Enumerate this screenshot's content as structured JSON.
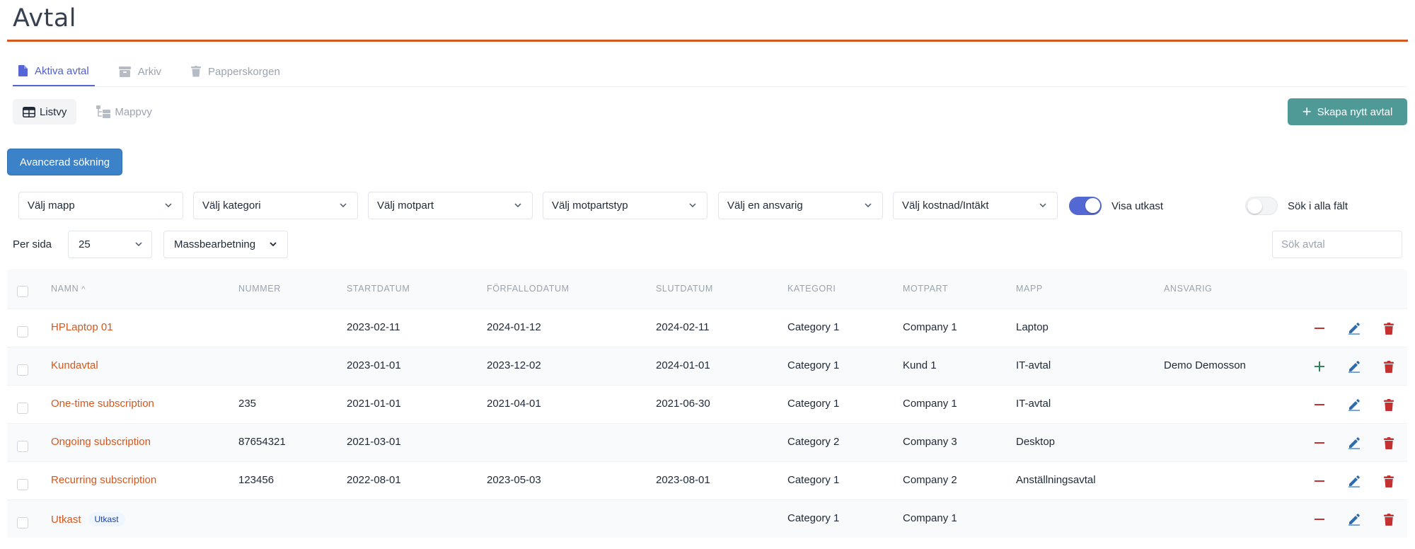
{
  "page": {
    "title": "Avtal"
  },
  "tabs": [
    {
      "label": "Aktiva avtal",
      "icon": "file-icon",
      "active": true
    },
    {
      "label": "Arkiv",
      "icon": "archive-icon",
      "active": false
    },
    {
      "label": "Papperskorgen",
      "icon": "trash-icon",
      "active": false
    }
  ],
  "views": [
    {
      "label": "Listvy",
      "icon": "table-icon",
      "active": true
    },
    {
      "label": "Mappvy",
      "icon": "folder-tree-icon",
      "active": false
    }
  ],
  "actions": {
    "create_label": "Skapa nytt avtal",
    "advanced_search_label": "Avancerad sökning"
  },
  "filters": [
    {
      "placeholder": "Välj mapp"
    },
    {
      "placeholder": "Välj kategori"
    },
    {
      "placeholder": "Välj motpart"
    },
    {
      "placeholder": "Välj motpartstyp"
    },
    {
      "placeholder": "Välj en ansvarig"
    },
    {
      "placeholder": "Välj kostnad/Intäkt"
    }
  ],
  "toggles": {
    "drafts": {
      "label": "Visa utkast",
      "on": true
    },
    "all_fields": {
      "label": "Sök i alla fält",
      "on": false
    }
  },
  "paging": {
    "per_page_label": "Per sida",
    "per_page_value": "25",
    "mass_label": "Massbearbetning"
  },
  "search": {
    "placeholder": "Sök avtal",
    "value": ""
  },
  "table": {
    "columns": [
      "NAMN",
      "NUMMER",
      "STARTDATUM",
      "FÖRFALLODATUM",
      "SLUTDATUM",
      "KATEGORI",
      "MOTPART",
      "MAPP",
      "ANSVARIG"
    ],
    "sort_indicator": "^",
    "rows": [
      {
        "name": "HPLaptop 01",
        "number": "",
        "start": "2023-02-11",
        "due": "2024-01-12",
        "end": "2024-02-11",
        "category": "Category 1",
        "party": "Company 1",
        "folder": "Laptop",
        "owner": "",
        "badge": "",
        "toggle": "minus"
      },
      {
        "name": "Kundavtal",
        "number": "",
        "start": "2023-01-01",
        "due": "2023-12-02",
        "end": "2024-01-01",
        "category": "Category 1",
        "party": "Kund 1",
        "folder": "IT-avtal",
        "owner": "Demo Demosson",
        "badge": "",
        "toggle": "plus"
      },
      {
        "name": "One-time subscription",
        "number": "235",
        "start": "2021-01-01",
        "due": "2021-04-01",
        "end": "2021-06-30",
        "category": "Category 1",
        "party": "Company 1",
        "folder": "IT-avtal",
        "owner": "",
        "badge": "",
        "toggle": "minus"
      },
      {
        "name": "Ongoing subscription",
        "number": "87654321",
        "start": "2021-03-01",
        "due": "",
        "end": "",
        "category": "Category 2",
        "party": "Company 3",
        "folder": "Desktop",
        "owner": "",
        "badge": "",
        "toggle": "minus"
      },
      {
        "name": "Recurring subscription",
        "number": "123456",
        "start": "2022-08-01",
        "due": "2023-05-03",
        "end": "2023-08-01",
        "category": "Category 1",
        "party": "Company 2",
        "folder": "Anställningsavtal",
        "owner": "",
        "badge": "",
        "toggle": "minus"
      },
      {
        "name": "Utkast",
        "number": "",
        "start": "",
        "due": "",
        "end": "",
        "category": "Category 1",
        "party": "Company 1",
        "folder": "",
        "owner": "",
        "badge": "Utkast",
        "toggle": "minus"
      }
    ]
  },
  "colors": {
    "accent": "#d4581f",
    "primary": "#3b82c8",
    "teal": "#4f9a96",
    "indigo": "#5468d4",
    "danger": "#c53030",
    "success": "#2f855a",
    "edit": "#2b6cb0"
  }
}
